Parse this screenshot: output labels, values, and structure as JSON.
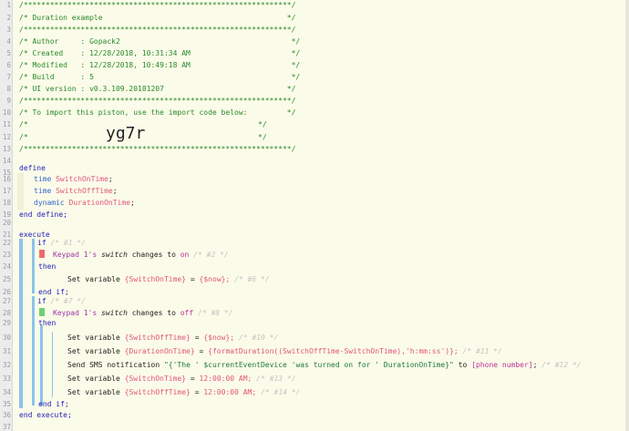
{
  "line_numbers": [
    "1",
    "2",
    "3",
    "4",
    "5",
    "6",
    "7",
    "8",
    "9",
    "10",
    "11",
    "12",
    "13",
    "14",
    "15",
    "16",
    "17",
    "18",
    "19",
    "20",
    "21",
    "22",
    "23",
    "24",
    "25",
    "26",
    "27",
    "28",
    "29",
    "30",
    "31",
    "32",
    "33",
    "34",
    "35",
    "36",
    "37"
  ],
  "header": {
    "border": "/*************************************************************/",
    "title": "/* Duration example                                          */",
    "author": "/* Author     : Gopack2                                       */",
    "created": "/* Created    : 12/28/2018, 10:31:34 AM                       */",
    "modified": "/* Modified   : 12/28/2018, 10:49:18 AM                       */",
    "build": "/* Build      : 5                                             */",
    "ui_version": "/* UI version : v0.3.109.20181207                            */",
    "import_line": "/* To import this piston, use the import code below:         */",
    "blank_open": "/*",
    "blank_close": "*/",
    "import_code": "yg7r"
  },
  "define_block": {
    "define": "define",
    "vars": [
      {
        "type": "time",
        "name": "SwitchOnTime",
        "end": ";"
      },
      {
        "type": "time",
        "name": "SwitchOffTime",
        "end": ";"
      },
      {
        "type": "dynamic",
        "name": "DurationOnTime",
        "end": ";"
      }
    ],
    "end": "end define;"
  },
  "execute_block": {
    "execute": "execute",
    "if1": {
      "kw": "if",
      "ghost": "/* #1 */"
    },
    "cond1": {
      "device": "Keypad 1",
      "apos": "'s",
      "attr": "switch",
      "changes": "changes to",
      "value": "on",
      "ghost": "/* #2 */"
    },
    "then1": "then",
    "set1": {
      "pre": "Set variable",
      "var": "{SwitchOnTime}",
      "eq": "=",
      "val": "{$now};",
      "ghost": "/* #6 */"
    },
    "endif1": "end if;",
    "if2": {
      "kw": "if",
      "ghost": "/* #7 */"
    },
    "cond2": {
      "device": "Keypad 1",
      "apos": "'s",
      "attr": "switch",
      "changes": "changes to",
      "value": "off",
      "ghost": "/* #8 */"
    },
    "then2": "then",
    "set2": {
      "pre": "Set variable",
      "var": "{SwitchOffTime}",
      "eq": "=",
      "val": "{$now};",
      "ghost": "/* #10 */"
    },
    "set3": {
      "pre": "Set variable",
      "var": "{DurationOnTime}",
      "eq": "=",
      "val": "{formatDuration((SwitchOffTime-SwitchOnTime),'h:mm:ss')};",
      "ghost": "/* #11 */"
    },
    "sms": {
      "pre": "Send SMS notification",
      "msg": "\"{'The ' $currentEventDevice 'was turned on for ' DurationOnTime}\"",
      "to": "to",
      "phone": "[phone number]",
      "end": ";",
      "ghost": "/* #12 */"
    },
    "set4": {
      "pre": "Set variable",
      "var": "{SwitchOnTime}",
      "eq": "=",
      "val": "12:00:00 AM;",
      "ghost": "/* #13 */"
    },
    "set5": {
      "pre": "Set variable",
      "var": "{SwitchOffTime}",
      "eq": "=",
      "val": "12:00:00 AM;",
      "ghost": "/* #14 */"
    },
    "endif2": "end if;",
    "end": "end execute;"
  },
  "colors": {
    "background": "#fbfbe9",
    "comment": "#2a8a2a",
    "keyword": "#2222bb",
    "variable": "#e0567a",
    "device": "#9b37a8",
    "block_bar": "#8cc3ec",
    "condition_on": "#ec6b6b",
    "condition_off": "#6fd16f"
  }
}
